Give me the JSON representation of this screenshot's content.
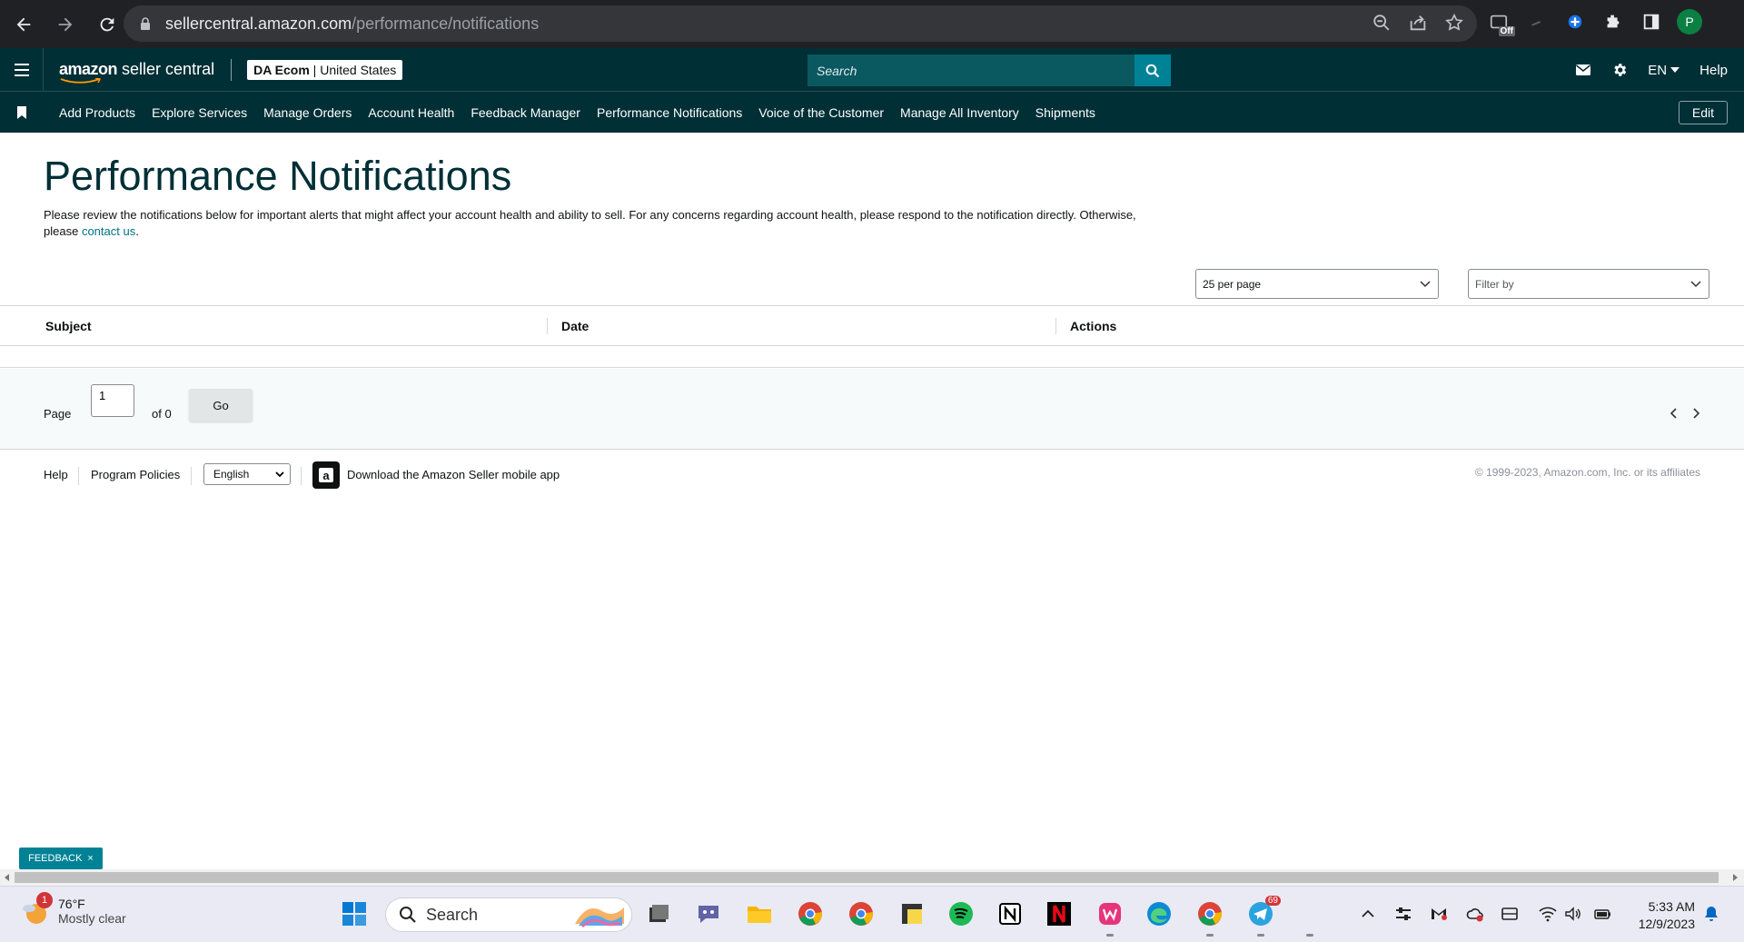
{
  "browser": {
    "url_host": "sellercentral.amazon.com",
    "url_path": "/performance/notifications",
    "extension_badge": "Off",
    "profile_initial": "P"
  },
  "header": {
    "logo_brand": "amazon",
    "logo_product": "seller central",
    "account_name": "DA Ecom",
    "account_region": "United States",
    "search_placeholder": "Search",
    "language": "EN",
    "help": "Help"
  },
  "bookmarks": {
    "items": [
      "Add Products",
      "Explore Services",
      "Manage Orders",
      "Account Health",
      "Feedback Manager",
      "Performance Notifications",
      "Voice of the Customer",
      "Manage All Inventory",
      "Shipments"
    ],
    "edit_label": "Edit"
  },
  "main": {
    "title": "Performance Notifications",
    "description": "Please review the notifications below for important alerts that might affect your account health and ability to sell. For any concerns regarding account health, please respond to the notification directly. Otherwise, please",
    "contact_link": "contact us",
    "description_end": ".",
    "per_page": "25 per page",
    "filter_placeholder": "Filter by",
    "columns": [
      "Subject",
      "Date",
      "Actions"
    ]
  },
  "pager": {
    "page_label": "Page",
    "page_value": "1",
    "of_label": "of 0",
    "go_label": "Go"
  },
  "footer": {
    "help": "Help",
    "program_policies": "Program Policies",
    "language": "English",
    "app_download": "Download the Amazon Seller mobile app",
    "copyright": "© 1999-2023, Amazon.com, Inc. or its affiliates"
  },
  "feedback": {
    "label": "FEEDBACK",
    "close": "×"
  },
  "taskbar": {
    "weather_badge": "1",
    "temperature": "76°F",
    "condition": "Mostly clear",
    "search_label": "Search",
    "telegram_badge": "69",
    "time": "5:33 AM",
    "date": "12/9/2023"
  },
  "colors": {
    "header_bg": "#002f36",
    "accent": "#008296",
    "link": "#007185"
  }
}
